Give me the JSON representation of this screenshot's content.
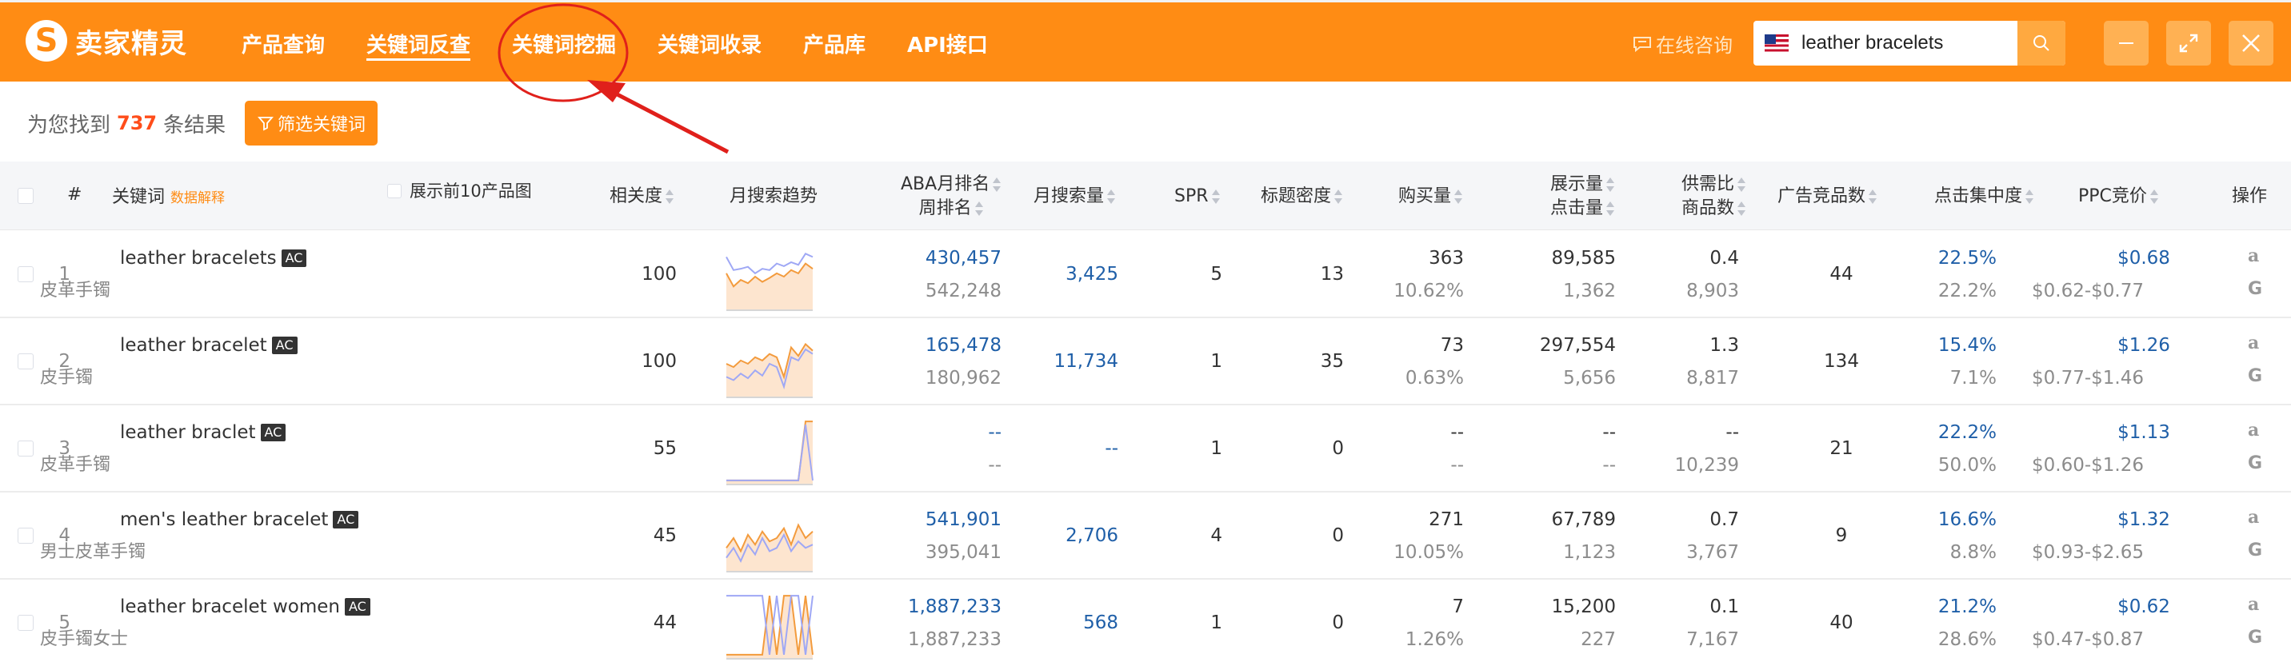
{
  "app": {
    "logo_text": "卖家精灵",
    "nav": [
      "产品查询",
      "关键词反查",
      "关键词挖掘",
      "关键词收录",
      "产品库",
      "API接口"
    ],
    "active_nav_index": 1,
    "consult": "在线咨询",
    "search_value": "leather bracelets",
    "brand_color": "#ff8c14"
  },
  "summary": {
    "prefix": "为您找到",
    "count": "737",
    "suffix": "条结果",
    "filter_button": "筛选关键词"
  },
  "table": {
    "headers": {
      "index": "#",
      "keyword": "关键词",
      "keyword_hint": "数据解释",
      "show_top10": "展示前10产品图",
      "relevance": "相关度",
      "trend": "月搜索趋势",
      "aba_rank": "ABA月排名",
      "week_rank": "周排名",
      "monthly_search": "月搜索量",
      "spr": "SPR",
      "title_density": "标题密度",
      "purchases": "购买量",
      "impressions": "展示量",
      "clicks": "点击量",
      "supply_demand": "供需比",
      "products": "商品数",
      "ad_products": "广告竞品数",
      "click_concentration": "点击集中度",
      "ppc": "PPC竞价",
      "ops": "操作"
    },
    "rows": [
      {
        "index": "1",
        "keyword": "leather bracelets",
        "tag": "AC",
        "cn": "皮革手镯",
        "relevance": "100",
        "aba": "430,457",
        "week": "542,248",
        "search": "3,425",
        "spr": "5",
        "density": "13",
        "purchase": "363",
        "purchase_rate": "10.62%",
        "impressions": "89,585",
        "clicks": "1,362",
        "ratio": "0.4",
        "products": "8,903",
        "ads": "44",
        "conc": "22.5%",
        "conc2": "22.2%",
        "ppc": "$0.68",
        "ppc_range": "$0.62-$0.77",
        "trend_orange": [
          0.55,
          0.35,
          0.45,
          0.4,
          0.5,
          0.42,
          0.48,
          0.55,
          0.5,
          0.6,
          0.55,
          0.7,
          0.62
        ],
        "trend_blue": [
          0.8,
          0.6,
          0.62,
          0.65,
          0.55,
          0.62,
          0.6,
          0.7,
          0.66,
          0.72,
          0.68,
          0.85,
          0.8
        ]
      },
      {
        "index": "2",
        "keyword": "leather bracelet",
        "tag": "AC",
        "cn": "皮手镯",
        "relevance": "100",
        "aba": "165,478",
        "week": "180,962",
        "search": "11,734",
        "spr": "1",
        "density": "35",
        "purchase": "73",
        "purchase_rate": "0.63%",
        "impressions": "297,554",
        "clicks": "5,656",
        "ratio": "1.3",
        "products": "8,817",
        "ads": "134",
        "conc": "15.4%",
        "conc2": "7.1%",
        "ppc": "$1.26",
        "ppc_range": "$0.77-$1.46",
        "trend_orange": [
          0.5,
          0.45,
          0.55,
          0.5,
          0.6,
          0.55,
          0.65,
          0.6,
          0.3,
          0.75,
          0.62,
          0.8,
          0.7
        ],
        "trend_blue": [
          0.3,
          0.25,
          0.35,
          0.28,
          0.4,
          0.32,
          0.5,
          0.45,
          0.15,
          0.6,
          0.55,
          0.72,
          0.65
        ]
      },
      {
        "index": "3",
        "keyword": "leather braclet",
        "tag": "AC",
        "cn": "皮革手镯",
        "relevance": "55",
        "aba": "--",
        "week": "--",
        "search": "--",
        "spr": "1",
        "density": "0",
        "purchase": "--",
        "purchase_rate": "--",
        "impressions": "--",
        "clicks": "--",
        "ratio": "--",
        "products": "10,239",
        "ads": "21",
        "conc": "22.2%",
        "conc2": "50.0%",
        "ppc": "$1.13",
        "ppc_range": "$0.60-$1.26",
        "trend_orange": [
          0.05,
          0.05,
          0.05,
          0.05,
          0.05,
          0.05,
          0.05,
          0.05,
          0.05,
          0.05,
          0.05,
          0.95,
          0.95
        ],
        "trend_blue": [
          0.05,
          0.05,
          0.05,
          0.05,
          0.05,
          0.05,
          0.05,
          0.05,
          0.05,
          0.05,
          0.05,
          0.9,
          0.05
        ]
      },
      {
        "index": "4",
        "keyword": "men's leather bracelet",
        "tag": "AC",
        "cn": "男士皮革手镯",
        "relevance": "45",
        "aba": "541,901",
        "week": "395,041",
        "search": "2,706",
        "spr": "4",
        "density": "0",
        "purchase": "271",
        "purchase_rate": "10.05%",
        "impressions": "67,789",
        "clicks": "1,123",
        "ratio": "0.7",
        "products": "3,767",
        "ads": "9",
        "conc": "16.6%",
        "conc2": "8.8%",
        "ppc": "$1.32",
        "ppc_range": "$0.93-$2.65",
        "trend_orange": [
          0.35,
          0.5,
          0.3,
          0.55,
          0.4,
          0.6,
          0.45,
          0.5,
          0.65,
          0.4,
          0.7,
          0.5,
          0.6
        ],
        "trend_blue": [
          0.2,
          0.35,
          0.15,
          0.4,
          0.25,
          0.5,
          0.3,
          0.35,
          0.55,
          0.3,
          0.45,
          0.35,
          0.4
        ]
      },
      {
        "index": "5",
        "keyword": "leather bracelet women",
        "tag": "AC",
        "cn": "皮手镯女士",
        "relevance": "44",
        "aba": "1,887,233",
        "week": "1,887,233",
        "search": "568",
        "spr": "1",
        "density": "0",
        "purchase": "7",
        "purchase_rate": "1.26%",
        "impressions": "15,200",
        "clicks": "227",
        "ratio": "0.1",
        "products": "7,167",
        "ads": "40",
        "conc": "21.2%",
        "conc2": "28.6%",
        "ppc": "$0.62",
        "ppc_range": "$0.47-$0.87",
        "trend_orange": [
          0.05,
          0.05,
          0.05,
          0.05,
          0.05,
          0.05,
          0.95,
          0.05,
          0.95,
          0.95,
          0.05,
          0.95,
          0.05
        ],
        "trend_blue": [
          0.95,
          0.95,
          0.95,
          0.95,
          0.95,
          0.95,
          0.05,
          0.95,
          0.05,
          0.95,
          0.95,
          0.05,
          0.95
        ]
      }
    ]
  },
  "ops_labels": {
    "amazon": "a",
    "google": "G"
  }
}
